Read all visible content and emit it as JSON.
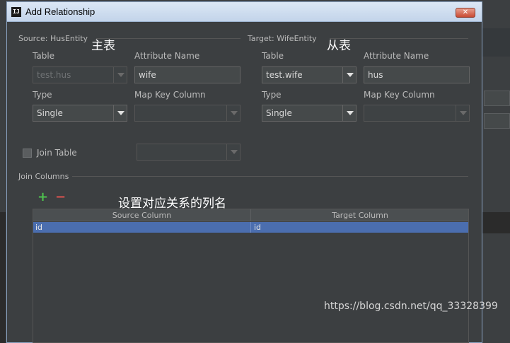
{
  "window": {
    "title": "Add Relationship",
    "icon_label": "IJ",
    "close_symbol": "✕"
  },
  "source": {
    "section_title": "Source: HusEntity",
    "annotation": "主表",
    "table_label": "Table",
    "table_value": "test.hus",
    "attribute_label": "Attribute Name",
    "attribute_value": "wife",
    "type_label": "Type",
    "type_value": "Single",
    "map_key_label": "Map Key Column",
    "map_key_value": ""
  },
  "target": {
    "section_title": "Target: WifeEntity",
    "annotation": "从表",
    "table_label": "Table",
    "table_value": "test.wife",
    "attribute_label": "Attribute Name",
    "attribute_value": "hus",
    "type_label": "Type",
    "type_value": "Single",
    "map_key_label": "Map Key Column",
    "map_key_value": ""
  },
  "join_table": {
    "label": "Join Table",
    "checked": false,
    "value": ""
  },
  "join_columns": {
    "section_title": "Join Columns",
    "annotation": "设置对应关系的列名",
    "add_symbol": "+",
    "remove_symbol": "−",
    "columns": [
      "Source Column",
      "Target Column"
    ],
    "rows": [
      {
        "source": "id",
        "target": "id"
      }
    ]
  },
  "watermark": "https://blog.csdn.net/qq_33328399"
}
